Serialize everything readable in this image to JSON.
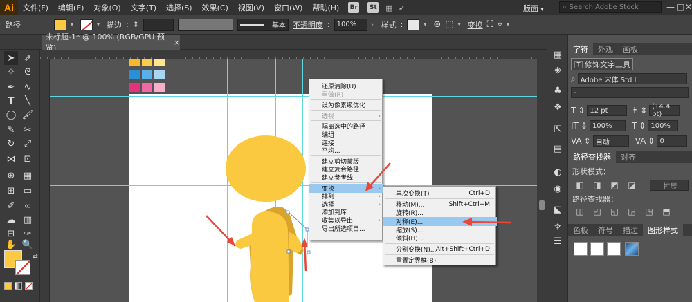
{
  "app": {
    "logo": "Ai"
  },
  "menubar": {
    "items": [
      "文件(F)",
      "编辑(E)",
      "对象(O)",
      "文字(T)",
      "选择(S)",
      "效果(C)",
      "视图(V)",
      "窗口(W)",
      "帮助(H)"
    ],
    "bridge_label": "Br",
    "stock_label": "St",
    "workspace": "版面",
    "search_placeholder": "Search Adobe Stock"
  },
  "control_bar": {
    "selection_type": "路径",
    "stroke_label": "描边",
    "stroke_style": "基本",
    "opacity_label": "不透明度",
    "opacity_value": "100%",
    "style_label": "样式",
    "transform_label": "变换"
  },
  "document_tab": {
    "title": "未标题-1* @ 100% (RGB/GPU 预览)",
    "close": "×"
  },
  "swatches": {
    "rows": [
      [
        "#f7b82a",
        "#fbcb4a",
        "#fde592"
      ],
      [
        "#2b8fd8",
        "#5ab0e8",
        "#a6d6f4"
      ],
      [
        "#e2337f",
        "#ef6aa4",
        "#f6aecb"
      ]
    ]
  },
  "character_panel": {
    "tabs": [
      "字符",
      "外观",
      "画板"
    ],
    "touch_type_button": "修饰文字工具",
    "font_family": "Adobe 宋体 Std L",
    "font_style": "-",
    "size": "12 pt",
    "leading": "(14.4 pt)",
    "vscale": "100%",
    "hscale": "100%",
    "kerning": "自动",
    "tracking": "0"
  },
  "pathfinder_panel": {
    "tabs": [
      "路径查找器",
      "对齐"
    ],
    "shape_modes_label": "形状模式：",
    "expand_button": "扩展",
    "pathfinders_label": "路径查找器："
  },
  "bottom_panel": {
    "tabs": [
      "色板",
      "符号",
      "描边",
      "图形样式"
    ]
  },
  "context_menu": {
    "items": [
      {
        "label": "还原清除(U)",
        "disabled": false
      },
      {
        "label": "重做(R)",
        "disabled": true
      },
      {
        "sep": true
      },
      {
        "label": "设为像素级优化",
        "disabled": false
      },
      {
        "sep": true
      },
      {
        "label": "透视",
        "disabled": true,
        "submenu": true
      },
      {
        "sep": true
      },
      {
        "label": "隔离选中的路径",
        "disabled": false
      },
      {
        "label": "编组",
        "disabled": false
      },
      {
        "label": "连接",
        "disabled": false
      },
      {
        "label": "平均...",
        "disabled": false
      },
      {
        "sep": true
      },
      {
        "label": "建立剪切蒙版",
        "disabled": false
      },
      {
        "label": "建立复合路径",
        "disabled": false
      },
      {
        "label": "建立参考线",
        "disabled": false
      },
      {
        "sep": true
      },
      {
        "label": "变换",
        "disabled": false,
        "submenu": true,
        "highlighted": true
      },
      {
        "label": "排列",
        "disabled": false,
        "submenu": true
      },
      {
        "label": "选择",
        "disabled": false,
        "submenu": true
      },
      {
        "label": "添加到库",
        "disabled": false
      },
      {
        "label": "收集以导出",
        "disabled": false,
        "submenu": true
      },
      {
        "label": "导出所选项目...",
        "disabled": false
      }
    ]
  },
  "transform_submenu": {
    "items": [
      {
        "label": "再次变换(T)",
        "shortcut": "Ctrl+D"
      },
      {
        "sep": true
      },
      {
        "label": "移动(M)...",
        "shortcut": "Shift+Ctrl+M"
      },
      {
        "label": "旋转(R)...",
        "shortcut": ""
      },
      {
        "label": "对称(E)...",
        "shortcut": "",
        "highlighted": true
      },
      {
        "label": "缩放(S)...",
        "shortcut": ""
      },
      {
        "label": "倾斜(H)...",
        "shortcut": ""
      },
      {
        "sep": true
      },
      {
        "label": "分别变换(N)...",
        "shortcut": "Alt+Shift+Ctrl+D"
      },
      {
        "sep": true
      },
      {
        "label": "重置定界框(B)",
        "shortcut": ""
      }
    ]
  },
  "colors": {
    "fill": "#fcc940",
    "figure_main": "#fbc93f",
    "figure_shadow": "#d9a42e",
    "guides": "#5fd7e3",
    "highlight": "#99c9ef",
    "annotation": "#e8473a"
  }
}
